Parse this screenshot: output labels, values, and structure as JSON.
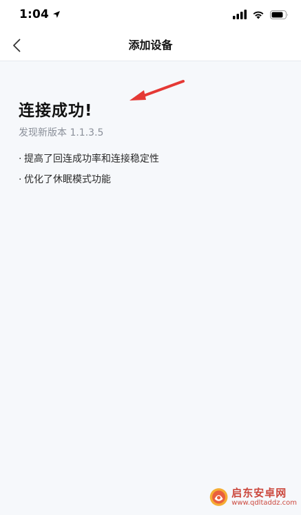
{
  "status_bar": {
    "time": "1:04",
    "icons": [
      "location-arrow-icon",
      "cellular-signal-icon",
      "wifi-icon",
      "battery-icon"
    ]
  },
  "nav": {
    "title": "添加设备",
    "back_icon": "chevron-left-icon"
  },
  "content": {
    "title": "连接成功!",
    "version": "发现新版本 1.1.3.5",
    "notes": [
      {
        "bullet": "·",
        "text": "提高了回连成功率和连接稳定性"
      },
      {
        "bullet": "·",
        "text": "优化了休眠模式功能"
      }
    ]
  },
  "annotation": {
    "type": "arrow",
    "color": "#e53935"
  },
  "watermark": {
    "name": "启东安卓网",
    "url": "www.qdltaddz.com"
  }
}
